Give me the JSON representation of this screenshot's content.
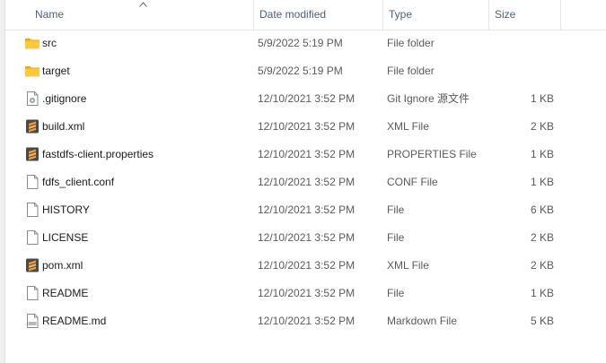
{
  "columns": {
    "name": "Name",
    "date": "Date modified",
    "type": "Type",
    "size": "Size"
  },
  "files": [
    {
      "name": "src",
      "date": "5/9/2022 5:19 PM",
      "type": "File folder",
      "size": "",
      "icon": "folder-icon"
    },
    {
      "name": "target",
      "date": "5/9/2022 5:19 PM",
      "type": "File folder",
      "size": "",
      "icon": "folder-icon"
    },
    {
      "name": ".gitignore",
      "date": "12/10/2021 3:52 PM",
      "type": "Git Ignore 源文件",
      "size": "1 KB",
      "icon": "gear-file-icon"
    },
    {
      "name": "build.xml",
      "date": "12/10/2021 3:52 PM",
      "type": "XML File",
      "size": "2 KB",
      "icon": "sublime-file-icon"
    },
    {
      "name": "fastdfs-client.properties",
      "date": "12/10/2021 3:52 PM",
      "type": "PROPERTIES File",
      "size": "1 KB",
      "icon": "sublime-file-icon"
    },
    {
      "name": "fdfs_client.conf",
      "date": "12/10/2021 3:52 PM",
      "type": "CONF File",
      "size": "1 KB",
      "icon": "blank-file-icon"
    },
    {
      "name": "HISTORY",
      "date": "12/10/2021 3:52 PM",
      "type": "File",
      "size": "6 KB",
      "icon": "blank-file-icon"
    },
    {
      "name": "LICENSE",
      "date": "12/10/2021 3:52 PM",
      "type": "File",
      "size": "2 KB",
      "icon": "blank-file-icon"
    },
    {
      "name": "pom.xml",
      "date": "12/10/2021 3:52 PM",
      "type": "XML File",
      "size": "2 KB",
      "icon": "sublime-file-icon"
    },
    {
      "name": "README",
      "date": "12/10/2021 3:52 PM",
      "type": "File",
      "size": "1 KB",
      "icon": "blank-file-icon"
    },
    {
      "name": "README.md",
      "date": "12/10/2021 3:52 PM",
      "type": "Markdown File",
      "size": "5 KB",
      "icon": "markdown-file-icon"
    }
  ],
  "colors": {
    "header_text": "#4c607a",
    "folder_yellow": "#ffc83d",
    "sublime_orange": "#f09b33"
  }
}
